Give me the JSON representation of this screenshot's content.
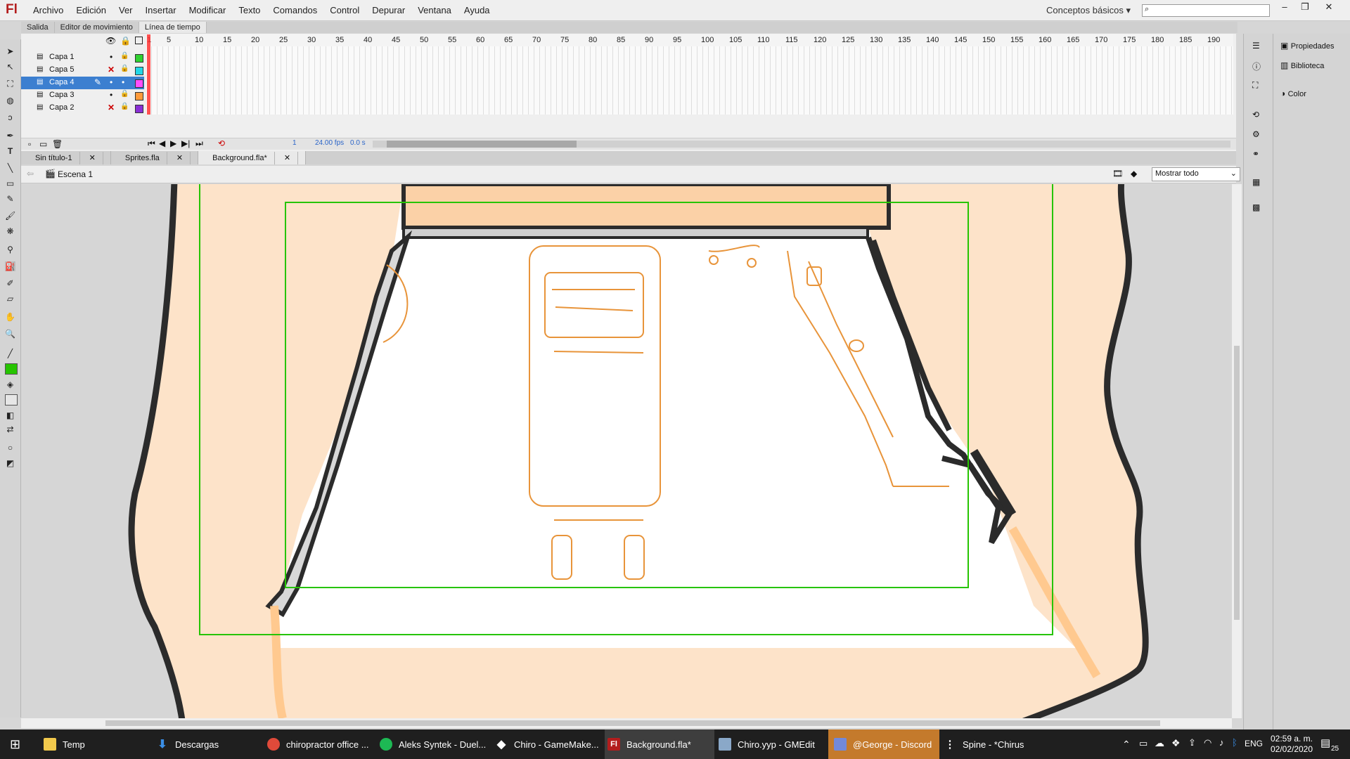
{
  "app": {
    "logo": "Fl"
  },
  "menu": [
    "Archivo",
    "Edición",
    "Ver",
    "Insertar",
    "Modificar",
    "Texto",
    "Comandos",
    "Control",
    "Depurar",
    "Ventana",
    "Ayuda"
  ],
  "workspace": "Conceptos básicos",
  "panel_tabs": [
    "Salida",
    "Editor de movimiento",
    "Línea de tiempo"
  ],
  "layers": [
    {
      "name": "Capa 1",
      "color": "#2fd12f",
      "hidden": false,
      "selected": false
    },
    {
      "name": "Capa 5",
      "color": "#22d7e7",
      "hidden": true,
      "selected": false
    },
    {
      "name": "Capa 4",
      "color": "#ff4dff",
      "hidden": false,
      "selected": true
    },
    {
      "name": "Capa 3",
      "color": "#ff9a3a",
      "hidden": false,
      "selected": false
    },
    {
      "name": "Capa 2",
      "color": "#8a2fd6",
      "hidden": true,
      "selected": false
    }
  ],
  "frame_ruler": [
    "1",
    "5",
    "10",
    "15",
    "20",
    "25",
    "30",
    "35",
    "40",
    "45",
    "50",
    "55",
    "60",
    "65",
    "70",
    "75",
    "80",
    "85",
    "90",
    "95",
    "100",
    "105",
    "110",
    "115",
    "120",
    "125",
    "130",
    "135",
    "140",
    "145",
    "150",
    "155",
    "160",
    "165",
    "170",
    "175",
    "180",
    "185",
    "190"
  ],
  "timeline_status": {
    "frame": "1",
    "fps": "24.00 fps",
    "time": "0.0 s"
  },
  "document_tabs": [
    "Sin título-1",
    "Sprites.fla",
    "Background.fla*"
  ],
  "scene": "Escena 1",
  "zoom": "Mostrar todo",
  "right_panels": [
    "Propiedades",
    "Biblioteca",
    "Color"
  ],
  "taskbar": [
    {
      "label": "Temp",
      "icon": "folder-icon",
      "color": "#f2c94c"
    },
    {
      "label": "Descargas",
      "icon": "download-icon",
      "color": "#3a8ee6"
    },
    {
      "label": "chiropractor office ...",
      "icon": "chrome-icon",
      "color": "#e04a3a"
    },
    {
      "label": "Aleks Syntek - Duel...",
      "icon": "spotify-icon",
      "color": "#1db954"
    },
    {
      "label": "Chiro - GameMake...",
      "icon": "gamemaker-icon",
      "color": "#ffffff"
    },
    {
      "label": "Background.fla*",
      "icon": "flash-icon",
      "color": "#b31d1d"
    },
    {
      "label": "Chiro.yyp - GMEdit",
      "icon": "gmedit-icon",
      "color": "#8aa8c8"
    },
    {
      "label": "@George - Discord",
      "icon": "discord-icon",
      "color": "#7289da"
    },
    {
      "label": "Spine - *Chirus",
      "icon": "spine-icon",
      "color": "#ffffff"
    }
  ],
  "tray": {
    "lang": "ENG",
    "time": "02:59 a. m.",
    "date": "02/02/2020",
    "notifications": "25"
  },
  "colors": {
    "stroke_green": "#26c400",
    "fill_peach": "#fde3c9",
    "sketch_orange": "#e8943a",
    "selection": "#3c7fd0"
  }
}
